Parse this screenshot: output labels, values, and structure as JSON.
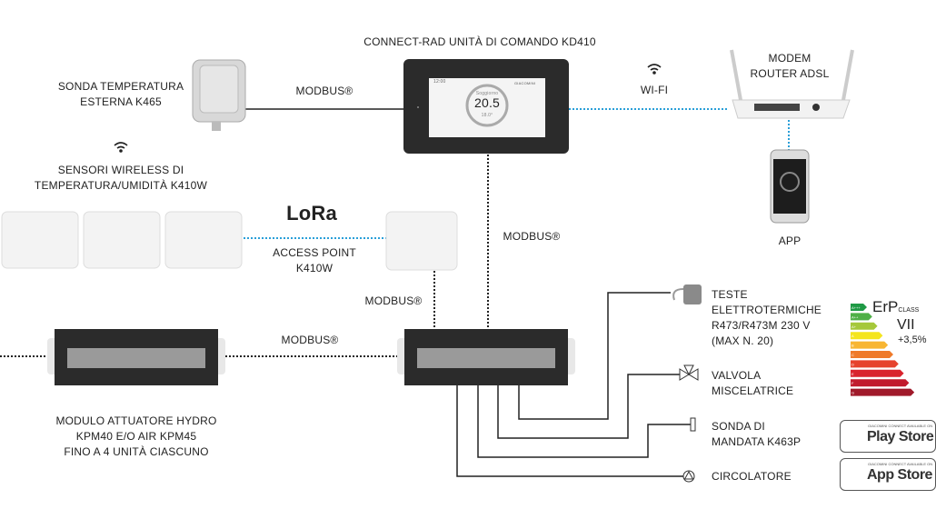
{
  "labels": {
    "control_unit": "CONNECT-RAD UNITÀ DI COMANDO KD410",
    "external_probe": [
      "SONDA TEMPERATURA",
      "ESTERNA K465"
    ],
    "modbus": "MODBUS®",
    "wifi": "WI-FI",
    "router": [
      "MODEM",
      "ROUTER ADSL"
    ],
    "wireless_sensors": [
      "SENSORI WIRELESS DI",
      "TEMPERATURA/UMIDITÀ K410W"
    ],
    "lora": "LoRa",
    "access_point": [
      "ACCESS POINT",
      "K410W"
    ],
    "app": "APP",
    "actuator_module": [
      "MODULO ATTUATORE HYDRO",
      "KPM40 E/O AIR KPM45",
      "FINO A 4 UNITÀ CIASCUNO"
    ],
    "thermo_heads": [
      "TESTE",
      "ELETTROTERMICHE",
      "R473/R473M 230 V",
      "(MAX N. 20)"
    ],
    "mixing_valve": [
      "VALVOLA",
      "MISCELATRICE"
    ],
    "flow_probe": [
      "SONDA DI",
      "MANDATA K463P"
    ],
    "circulator": "CIRCOLATORE"
  },
  "screen": {
    "time": "12:00",
    "mode": "Soggiorno",
    "temperature": "20.5",
    "setpoint": "18.0°",
    "brand": "GIACOMINI"
  },
  "erp": {
    "title": "ErP",
    "class_word": "CLASS",
    "class": "VII",
    "bonus": "+3,5%",
    "bands": [
      {
        "label": "A+++",
        "color": "#1f9a45"
      },
      {
        "label": "A++",
        "color": "#4fb047"
      },
      {
        "label": "A+",
        "color": "#a5c83a"
      },
      {
        "label": "A",
        "color": "#f4e51e"
      },
      {
        "label": "B",
        "color": "#f8b632"
      },
      {
        "label": "C",
        "color": "#ef7a2a"
      },
      {
        "label": "D",
        "color": "#e6422d"
      },
      {
        "label": "E",
        "color": "#d9242e"
      },
      {
        "label": "F",
        "color": "#c11b2d"
      },
      {
        "label": "G",
        "color": "#a01a2a"
      }
    ]
  },
  "stores": {
    "caption": "GIACOMINI CONNECT AVAILABLE ON",
    "play": "Play Store",
    "apple": "App Store"
  },
  "colors": {
    "wifi_link": "#2a9fd8",
    "wire": "#222222",
    "device": "#2b2b2b"
  }
}
